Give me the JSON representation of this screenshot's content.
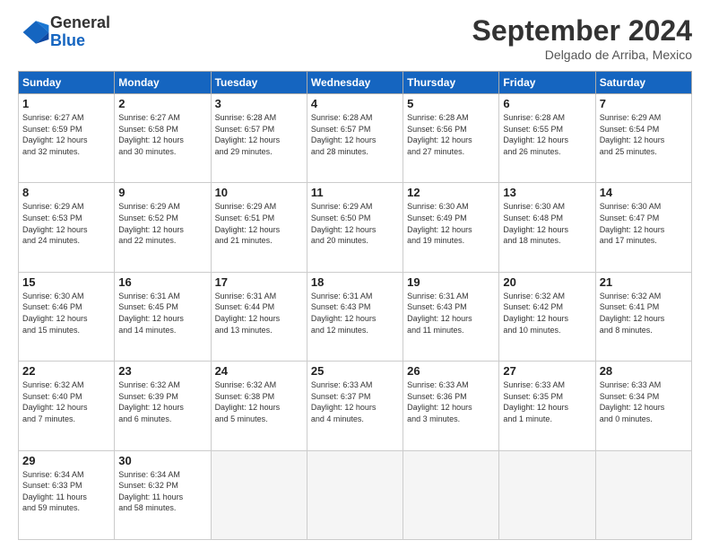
{
  "header": {
    "logo_general": "General",
    "logo_blue": "Blue",
    "month_title": "September 2024",
    "location": "Delgado de Arriba, Mexico"
  },
  "calendar": {
    "days_of_week": [
      "Sunday",
      "Monday",
      "Tuesday",
      "Wednesday",
      "Thursday",
      "Friday",
      "Saturday"
    ],
    "weeks": [
      [
        {
          "day": "1",
          "info": "Sunrise: 6:27 AM\nSunset: 6:59 PM\nDaylight: 12 hours\nand 32 minutes."
        },
        {
          "day": "2",
          "info": "Sunrise: 6:27 AM\nSunset: 6:58 PM\nDaylight: 12 hours\nand 30 minutes."
        },
        {
          "day": "3",
          "info": "Sunrise: 6:28 AM\nSunset: 6:57 PM\nDaylight: 12 hours\nand 29 minutes."
        },
        {
          "day": "4",
          "info": "Sunrise: 6:28 AM\nSunset: 6:57 PM\nDaylight: 12 hours\nand 28 minutes."
        },
        {
          "day": "5",
          "info": "Sunrise: 6:28 AM\nSunset: 6:56 PM\nDaylight: 12 hours\nand 27 minutes."
        },
        {
          "day": "6",
          "info": "Sunrise: 6:28 AM\nSunset: 6:55 PM\nDaylight: 12 hours\nand 26 minutes."
        },
        {
          "day": "7",
          "info": "Sunrise: 6:29 AM\nSunset: 6:54 PM\nDaylight: 12 hours\nand 25 minutes."
        }
      ],
      [
        {
          "day": "8",
          "info": "Sunrise: 6:29 AM\nSunset: 6:53 PM\nDaylight: 12 hours\nand 24 minutes."
        },
        {
          "day": "9",
          "info": "Sunrise: 6:29 AM\nSunset: 6:52 PM\nDaylight: 12 hours\nand 22 minutes."
        },
        {
          "day": "10",
          "info": "Sunrise: 6:29 AM\nSunset: 6:51 PM\nDaylight: 12 hours\nand 21 minutes."
        },
        {
          "day": "11",
          "info": "Sunrise: 6:29 AM\nSunset: 6:50 PM\nDaylight: 12 hours\nand 20 minutes."
        },
        {
          "day": "12",
          "info": "Sunrise: 6:30 AM\nSunset: 6:49 PM\nDaylight: 12 hours\nand 19 minutes."
        },
        {
          "day": "13",
          "info": "Sunrise: 6:30 AM\nSunset: 6:48 PM\nDaylight: 12 hours\nand 18 minutes."
        },
        {
          "day": "14",
          "info": "Sunrise: 6:30 AM\nSunset: 6:47 PM\nDaylight: 12 hours\nand 17 minutes."
        }
      ],
      [
        {
          "day": "15",
          "info": "Sunrise: 6:30 AM\nSunset: 6:46 PM\nDaylight: 12 hours\nand 15 minutes."
        },
        {
          "day": "16",
          "info": "Sunrise: 6:31 AM\nSunset: 6:45 PM\nDaylight: 12 hours\nand 14 minutes."
        },
        {
          "day": "17",
          "info": "Sunrise: 6:31 AM\nSunset: 6:44 PM\nDaylight: 12 hours\nand 13 minutes."
        },
        {
          "day": "18",
          "info": "Sunrise: 6:31 AM\nSunset: 6:43 PM\nDaylight: 12 hours\nand 12 minutes."
        },
        {
          "day": "19",
          "info": "Sunrise: 6:31 AM\nSunset: 6:43 PM\nDaylight: 12 hours\nand 11 minutes."
        },
        {
          "day": "20",
          "info": "Sunrise: 6:32 AM\nSunset: 6:42 PM\nDaylight: 12 hours\nand 10 minutes."
        },
        {
          "day": "21",
          "info": "Sunrise: 6:32 AM\nSunset: 6:41 PM\nDaylight: 12 hours\nand 8 minutes."
        }
      ],
      [
        {
          "day": "22",
          "info": "Sunrise: 6:32 AM\nSunset: 6:40 PM\nDaylight: 12 hours\nand 7 minutes."
        },
        {
          "day": "23",
          "info": "Sunrise: 6:32 AM\nSunset: 6:39 PM\nDaylight: 12 hours\nand 6 minutes."
        },
        {
          "day": "24",
          "info": "Sunrise: 6:32 AM\nSunset: 6:38 PM\nDaylight: 12 hours\nand 5 minutes."
        },
        {
          "day": "25",
          "info": "Sunrise: 6:33 AM\nSunset: 6:37 PM\nDaylight: 12 hours\nand 4 minutes."
        },
        {
          "day": "26",
          "info": "Sunrise: 6:33 AM\nSunset: 6:36 PM\nDaylight: 12 hours\nand 3 minutes."
        },
        {
          "day": "27",
          "info": "Sunrise: 6:33 AM\nSunset: 6:35 PM\nDaylight: 12 hours\nand 1 minute."
        },
        {
          "day": "28",
          "info": "Sunrise: 6:33 AM\nSunset: 6:34 PM\nDaylight: 12 hours\nand 0 minutes."
        }
      ],
      [
        {
          "day": "29",
          "info": "Sunrise: 6:34 AM\nSunset: 6:33 PM\nDaylight: 11 hours\nand 59 minutes."
        },
        {
          "day": "30",
          "info": "Sunrise: 6:34 AM\nSunset: 6:32 PM\nDaylight: 11 hours\nand 58 minutes."
        },
        {
          "day": "",
          "info": ""
        },
        {
          "day": "",
          "info": ""
        },
        {
          "day": "",
          "info": ""
        },
        {
          "day": "",
          "info": ""
        },
        {
          "day": "",
          "info": ""
        }
      ]
    ]
  }
}
